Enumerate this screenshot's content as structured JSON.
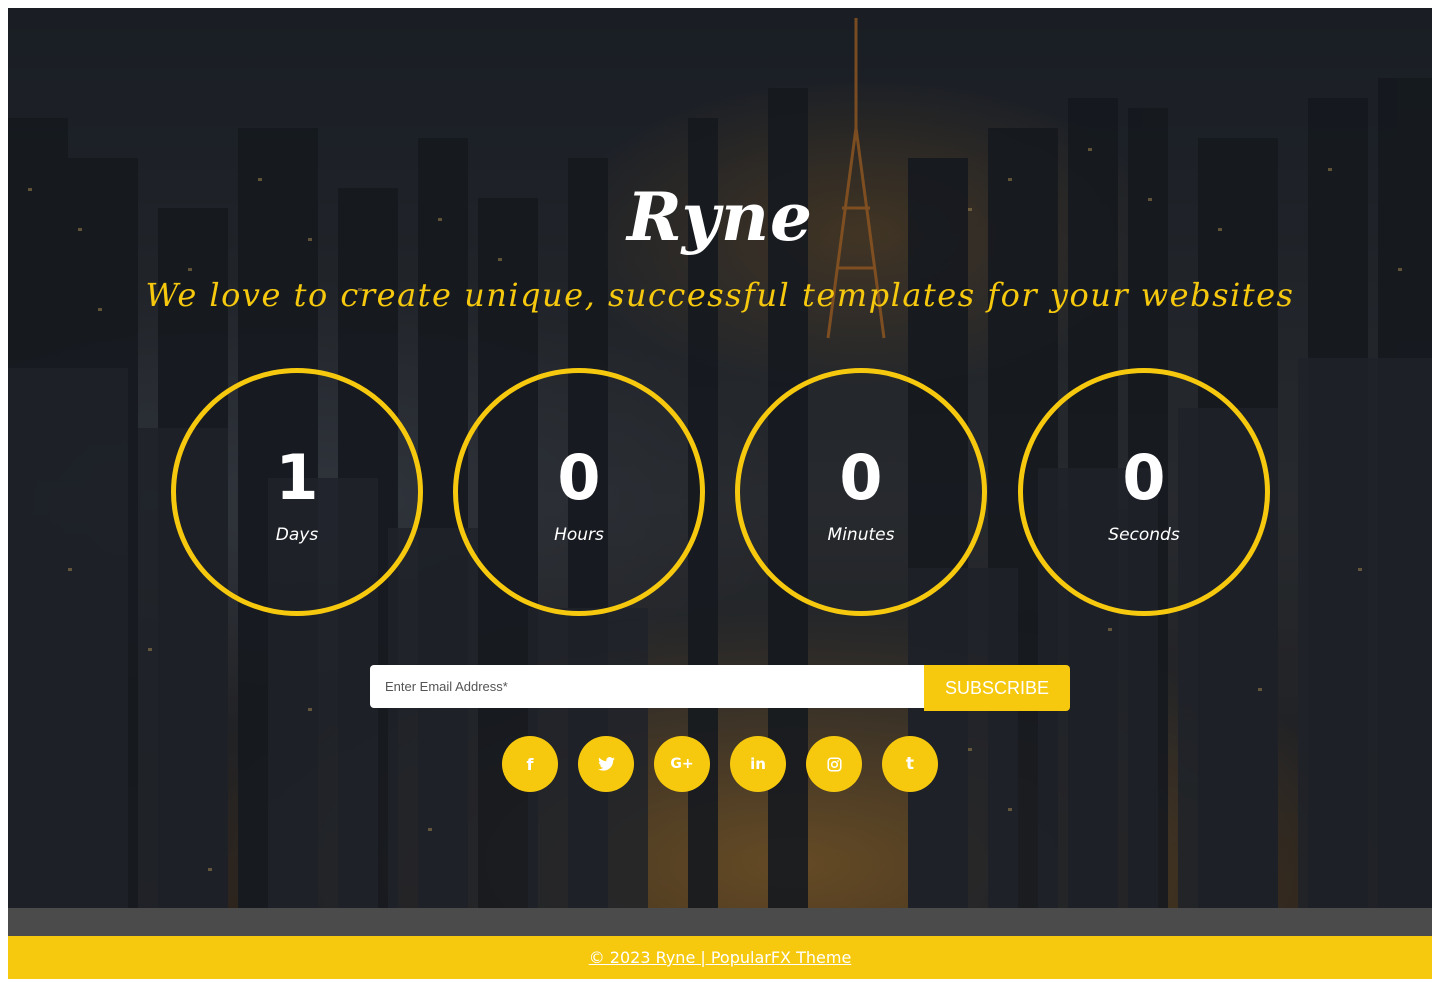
{
  "hero": {
    "brand": "Ryne",
    "tagline": "We love to create unique, successful templates for your websites"
  },
  "countdown": [
    {
      "value": "1",
      "label": "Days"
    },
    {
      "value": "0",
      "label": "Hours"
    },
    {
      "value": "0",
      "label": "Minutes"
    },
    {
      "value": "0",
      "label": "Seconds"
    }
  ],
  "subscribe": {
    "placeholder": "Enter Email Address*",
    "value": "",
    "button_label": "SUBSCRIBE"
  },
  "social": [
    {
      "icon": "facebook-icon",
      "glyph": "f"
    },
    {
      "icon": "twitter-icon",
      "glyph": ""
    },
    {
      "icon": "google-plus-icon",
      "glyph": "G+"
    },
    {
      "icon": "linkedin-icon",
      "glyph": "in"
    },
    {
      "icon": "instagram-icon",
      "glyph": ""
    },
    {
      "icon": "tumblr-icon",
      "glyph": "t"
    }
  ],
  "footer": {
    "copyright": "© 2023 Ryne | PopularFX Theme"
  },
  "colors": {
    "accent": "#f6c90e",
    "footer_bar": "#4b4b4b",
    "text_light": "#ffffff"
  }
}
